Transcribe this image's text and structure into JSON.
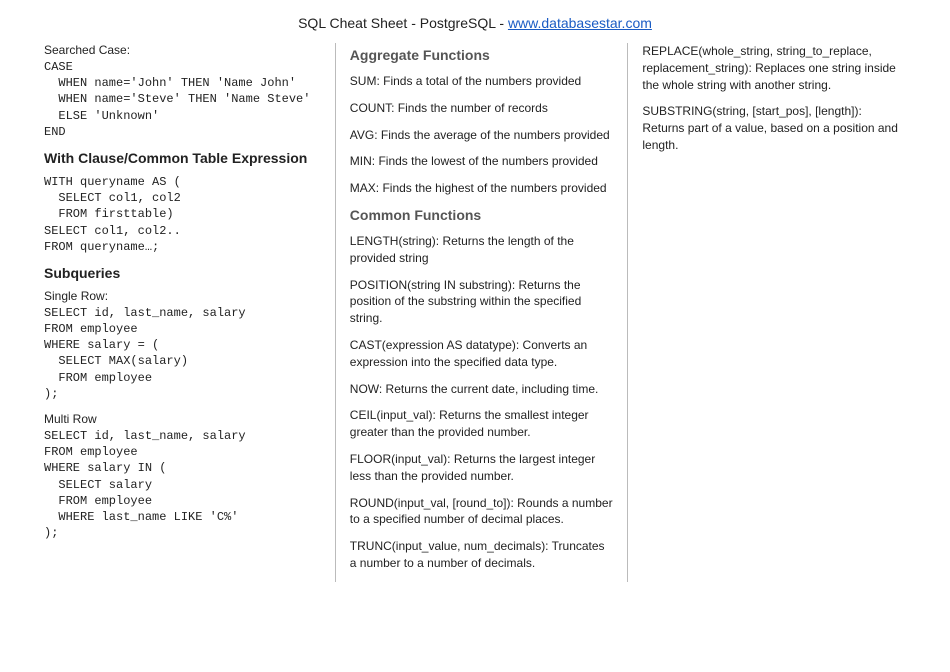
{
  "header": {
    "title_prefix": "SQL Cheat Sheet - PostgreSQL - ",
    "link_text": "www.databasestar.com"
  },
  "col1": {
    "searched_case_label": "Searched Case:",
    "searched_case_code": "CASE\n  WHEN name='John' THEN 'Name John'\n  WHEN name='Steve' THEN 'Name Steve'\n  ELSE 'Unknown'\nEND",
    "with_heading": "With Clause/Common Table Expression",
    "with_code": "WITH queryname AS (\n  SELECT col1, col2\n  FROM firsttable)\nSELECT col1, col2..\nFROM queryname…;",
    "subqueries_heading": "Subqueries",
    "single_row_label": "Single Row:",
    "single_row_code": "SELECT id, last_name, salary\nFROM employee\nWHERE salary = (\n  SELECT MAX(salary)\n  FROM employee\n);",
    "multi_row_label": "Multi Row",
    "multi_row_code": "SELECT id, last_name, salary\nFROM employee\nWHERE salary IN (\n  SELECT salary\n  FROM employee\n  WHERE last_name LIKE 'C%'\n);"
  },
  "col2": {
    "agg_heading": "Aggregate Functions",
    "agg_sum": "SUM: Finds a total of the numbers provided",
    "agg_count": "COUNT: Finds the number of records",
    "agg_avg": "AVG: Finds the average of the numbers provided",
    "agg_min": "MIN: Finds the lowest of the numbers provided",
    "agg_max": "MAX: Finds the highest of the numbers provided",
    "common_heading": "Common Functions",
    "fn_length": "LENGTH(string): Returns the length of the provided string",
    "fn_position": "POSITION(string IN substring): Returns the position of the substring within the specified string.",
    "fn_cast": "CAST(expression AS datatype): Converts an expression into the specified data type.",
    "fn_now": "NOW: Returns the current date, including time.",
    "fn_ceil": "CEIL(input_val): Returns the smallest integer greater than the provided number.",
    "fn_floor": "FLOOR(input_val): Returns the largest integer less than the provided number.",
    "fn_round": "ROUND(input_val, [round_to]): Rounds a number to a specified number of decimal places.",
    "fn_trunc": "TRUNC(input_value, num_decimals): Truncates a number to a number of decimals."
  },
  "col3": {
    "fn_replace": "REPLACE(whole_string, string_to_replace, replacement_string): Replaces one string inside the whole string with another string.",
    "fn_substring": "SUBSTRING(string, [start_pos], [length]): Returns part of a value, based on a position and length."
  }
}
